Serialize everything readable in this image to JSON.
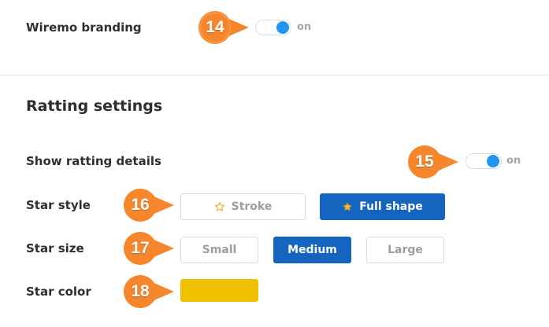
{
  "branding": {
    "label": "Wiremo branding",
    "toggle_state": "on",
    "callout": "14"
  },
  "rating_settings": {
    "title": "Ratting settings",
    "show_details": {
      "label": "Show ratting details",
      "toggle_state": "on",
      "callout": "15"
    },
    "star_style": {
      "label": "Star style",
      "callout": "16",
      "options": [
        "Stroke",
        "Full shape"
      ],
      "selected": "Full shape"
    },
    "star_size": {
      "label": "Star size",
      "callout": "17",
      "options": [
        "Small",
        "Medium",
        "Large"
      ],
      "selected": "Medium"
    },
    "star_color": {
      "label": "Star color",
      "callout": "18",
      "value": "#f0c000"
    }
  },
  "icons": {
    "stroke_star": "star-outline-icon",
    "full_star": "star-filled-icon"
  },
  "colors": {
    "accent": "#1565c0",
    "toggle_knob": "#2196f3",
    "callout_orange": "#f5862b",
    "star_fill": "#f5b320",
    "divider": "#e1e1ea"
  }
}
